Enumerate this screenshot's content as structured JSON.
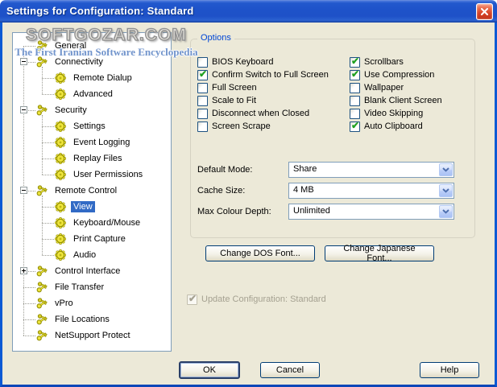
{
  "window": {
    "title": "Settings for Configuration: Standard",
    "close_icon": "close-icon"
  },
  "watermark": {
    "line1": "SOFTGOZAR.COM",
    "line2": "The First Iranian Software Encyclopedia"
  },
  "tree": {
    "items": [
      {
        "label": "General",
        "level": 1,
        "icon": "keys",
        "expander": null,
        "selected": false
      },
      {
        "label": "Connectivity",
        "level": 1,
        "icon": "keys",
        "expander": "minus",
        "selected": false
      },
      {
        "label": "Remote Dialup",
        "level": 2,
        "icon": "gear",
        "expander": null,
        "selected": false
      },
      {
        "label": "Advanced",
        "level": 2,
        "icon": "gear",
        "expander": null,
        "selected": false
      },
      {
        "label": "Security",
        "level": 1,
        "icon": "keys",
        "expander": "minus",
        "selected": false
      },
      {
        "label": "Settings",
        "level": 2,
        "icon": "gear",
        "expander": null,
        "selected": false
      },
      {
        "label": "Event Logging",
        "level": 2,
        "icon": "gear",
        "expander": null,
        "selected": false
      },
      {
        "label": "Replay Files",
        "level": 2,
        "icon": "gear",
        "expander": null,
        "selected": false
      },
      {
        "label": "User Permissions",
        "level": 2,
        "icon": "gear",
        "expander": null,
        "selected": false
      },
      {
        "label": "Remote Control",
        "level": 1,
        "icon": "keys",
        "expander": "minus",
        "selected": false
      },
      {
        "label": "View",
        "level": 2,
        "icon": "gear",
        "expander": null,
        "selected": true
      },
      {
        "label": "Keyboard/Mouse",
        "level": 2,
        "icon": "gear",
        "expander": null,
        "selected": false
      },
      {
        "label": "Print Capture",
        "level": 2,
        "icon": "gear",
        "expander": null,
        "selected": false
      },
      {
        "label": "Audio",
        "level": 2,
        "icon": "gear",
        "expander": null,
        "selected": false
      },
      {
        "label": "Control Interface",
        "level": 1,
        "icon": "keys",
        "expander": "plus",
        "selected": false
      },
      {
        "label": "File Transfer",
        "level": 1,
        "icon": "keys",
        "expander": null,
        "selected": false
      },
      {
        "label": "vPro",
        "level": 1,
        "icon": "keys",
        "expander": null,
        "selected": false
      },
      {
        "label": "File Locations",
        "level": 1,
        "icon": "keys",
        "expander": null,
        "selected": false
      },
      {
        "label": "NetSupport Protect",
        "level": 1,
        "icon": "keys",
        "expander": null,
        "selected": false
      }
    ]
  },
  "options": {
    "title": "Options",
    "checkboxes_left": [
      {
        "label": "BIOS Keyboard",
        "checked": false
      },
      {
        "label": "Confirm Switch to Full Screen",
        "checked": true
      },
      {
        "label": "Full Screen",
        "checked": false
      },
      {
        "label": "Scale to Fit",
        "checked": false
      },
      {
        "label": "Disconnect when Closed",
        "checked": false
      },
      {
        "label": "Screen Scrape",
        "checked": false
      }
    ],
    "checkboxes_right": [
      {
        "label": "Scrollbars",
        "checked": true
      },
      {
        "label": "Use Compression",
        "checked": true
      },
      {
        "label": "Wallpaper",
        "checked": false
      },
      {
        "label": "Blank Client Screen",
        "checked": false
      },
      {
        "label": "Video Skipping",
        "checked": false
      },
      {
        "label": "Auto Clipboard",
        "checked": true
      }
    ],
    "dropdowns": [
      {
        "label": "Default Mode:",
        "value": "Share"
      },
      {
        "label": "Cache Size:",
        "value": "4 MB"
      },
      {
        "label": "Max Colour Depth:",
        "value": "Unlimited"
      }
    ]
  },
  "font_buttons": {
    "dos": "Change DOS Font...",
    "japanese": "Change Japanese Font..."
  },
  "update_checkbox": {
    "label": "Update Configuration: Standard",
    "checked": true,
    "disabled": true
  },
  "footer": {
    "ok": "OK",
    "cancel": "Cancel",
    "help": "Help"
  },
  "colors": {
    "titlebar_blue": "#1E52C9",
    "dialog_bg": "#ECE9D8",
    "selection_blue": "#316AC5",
    "group_caption_blue": "#0046D5",
    "check_green": "#21A121",
    "close_red": "#D64327"
  }
}
